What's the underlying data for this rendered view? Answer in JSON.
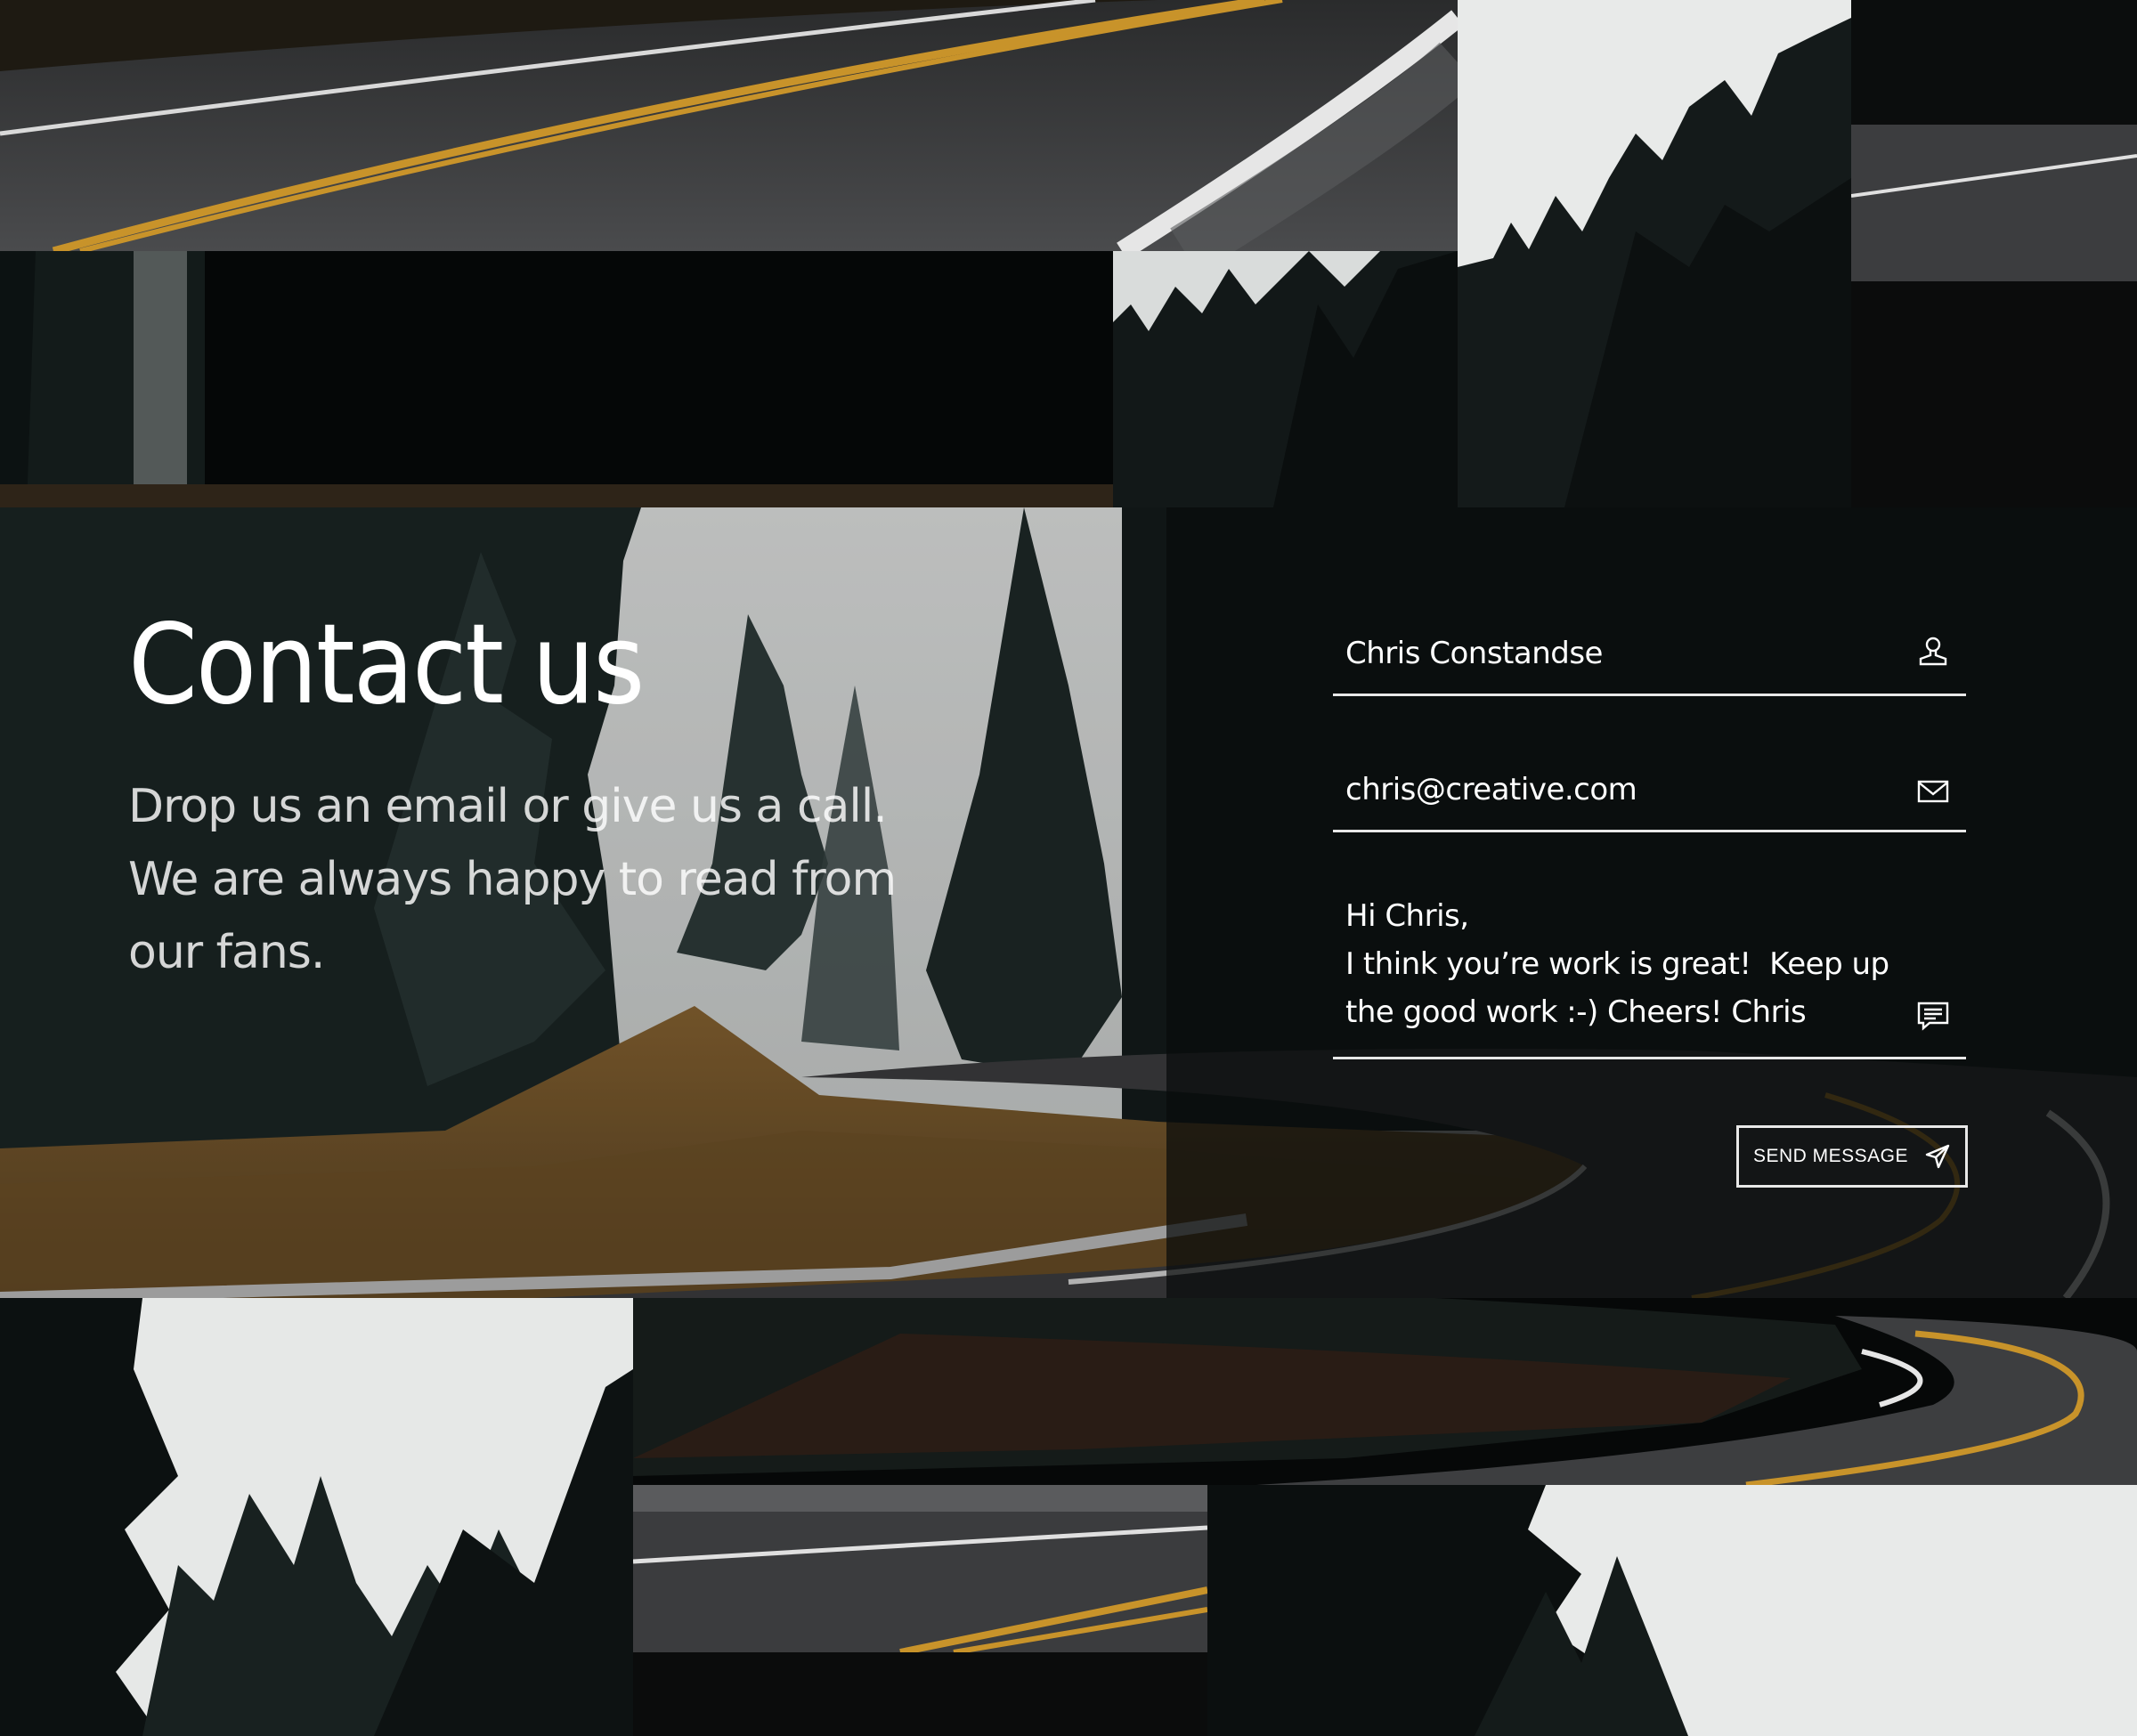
{
  "page": {
    "title": "Contact us",
    "subtitle": "Drop us an email or give us a call. We are always happy to read from our fans."
  },
  "form": {
    "name_value": "Chris Constandse",
    "email_value": "chris@creative.com",
    "message_value": "Hi Chris,\nI think you’re work is great!  Keep up the good work :-) Cheers! Chris",
    "send_label": "SEND MESSAGE"
  },
  "icons": {
    "name": "user-icon",
    "email": "envelope-icon",
    "message": "chat-bubble-icon",
    "send": "paper-plane-icon"
  },
  "colors": {
    "fog": "#e9ebea",
    "forest": "#0f1616",
    "asphalt": "#3a3b3c",
    "road_line_yellow": "#d9a22c",
    "grass": "#a6773a",
    "panel": "#080a0a"
  }
}
